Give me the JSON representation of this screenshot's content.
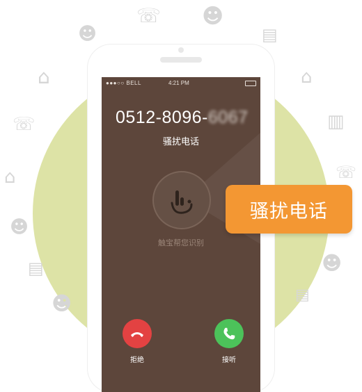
{
  "status_bar": {
    "carrier": "●●●○○ BELL",
    "time": "4:21 PM"
  },
  "call": {
    "number_visible": "0512-8096-",
    "number_hidden": "6067",
    "label": "骚扰电话"
  },
  "app": {
    "identify_text": "触宝帮您识别"
  },
  "actions": {
    "decline_label": "拒绝",
    "accept_label": "接听"
  },
  "badge": {
    "text": "骚扰电话"
  },
  "colors": {
    "background_circle": "#dde3a6",
    "screen": "#5d463b",
    "decline": "#e34242",
    "accept": "#4cc25a",
    "badge": "#f39733"
  },
  "icons": [
    "phone-blocked-icon",
    "monster-icon",
    "house-price-icon",
    "shop-icon",
    "bell-monster-icon",
    "coupon-icon",
    "emoji-icon"
  ]
}
